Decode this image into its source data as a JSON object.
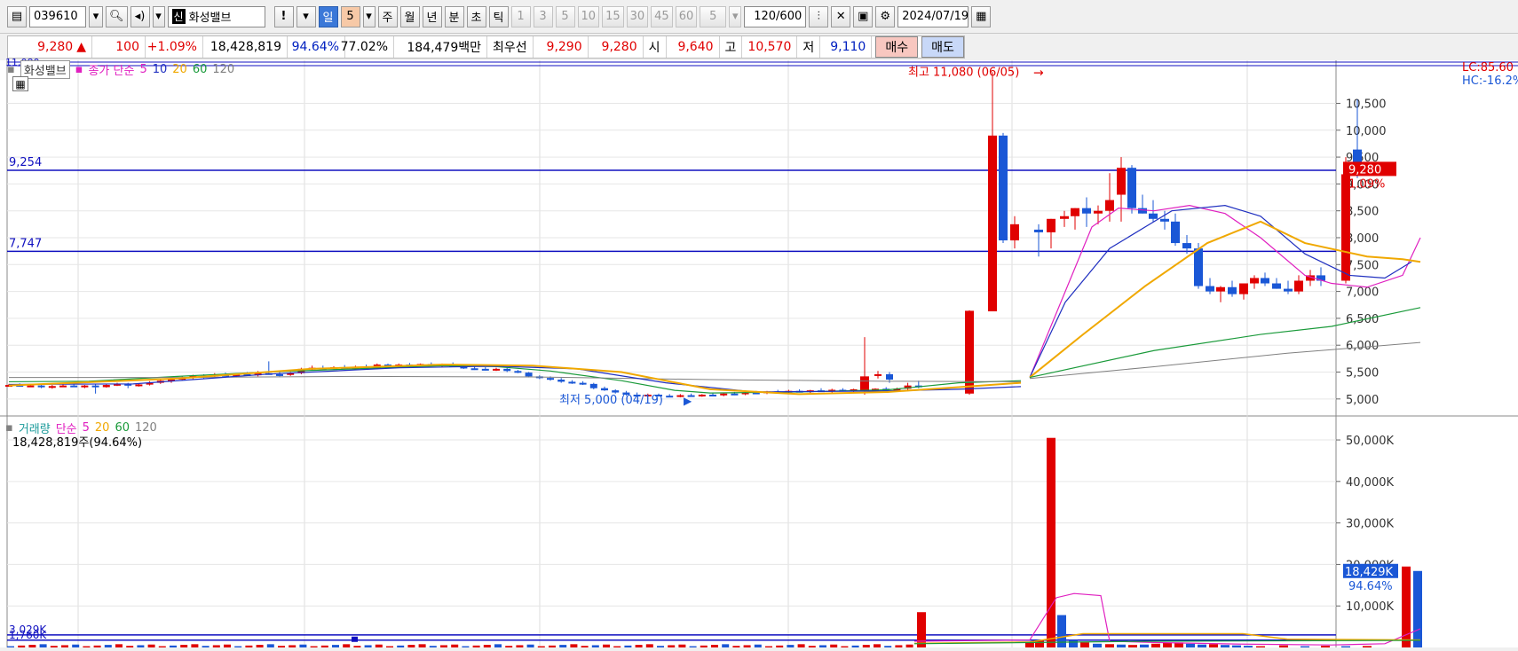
{
  "toolbar": {
    "code": "039610",
    "name_badge": "신",
    "stock_name": "화성밸브",
    "alert": "!",
    "period_day": "일",
    "period_value": "5",
    "period_week": "주",
    "period_month": "월",
    "period_year": "년",
    "period_min": "분",
    "period_sec": "초",
    "period_tick": "틱",
    "intervals": [
      "1",
      "3",
      "5",
      "10",
      "15",
      "30",
      "45",
      "60"
    ],
    "interval_select": "5",
    "count": "120",
    "count_max": "/600",
    "date": "2024/07/19"
  },
  "quote": {
    "price": "9,280",
    "change_arrow": "▲",
    "change": "100",
    "change_pct": "+1.09%",
    "volume": "18,428,819",
    "volume_ratio": "94.64%",
    "turnover": "77.02%",
    "amount": "184,479백만",
    "best_label": "최우선",
    "best_ask": "9,290",
    "best_bid": "9,280",
    "open_label": "시",
    "open": "9,640",
    "high_label": "고",
    "high": "10,570",
    "low_label": "저",
    "low": "9,110",
    "buy_button": "매수",
    "sell_button": "매도"
  },
  "price_panel": {
    "top_left_label": "11,080",
    "legend_name": "화성밸브",
    "legend_ma": "종가 단순",
    "ma_periods": [
      "5",
      "10",
      "20",
      "60",
      "120"
    ],
    "right_lc": "LC:85.60",
    "right_hc": "HC:-16.2%",
    "hline1_label": "9,254",
    "hline2_label": "7,747",
    "high_note": "최고 11,080 (06/05)",
    "low_note": "최저 5,000 (04/19)",
    "current_price": "9,280",
    "current_change": "1.09%",
    "y_ticks": [
      "10,500",
      "10,000",
      "9,500",
      "9,000",
      "8,500",
      "8,000",
      "7,500",
      "7,000",
      "6,500",
      "6,000",
      "5,500",
      "5,000"
    ]
  },
  "volume_panel": {
    "legend_name": "거래량",
    "legend_ma": "단순",
    "ma_periods": [
      "5",
      "20",
      "60",
      "120"
    ],
    "volume_text": "18,428,819주(94.64%)",
    "hline1_label": "3,029K",
    "hline2_label": "1,760K",
    "current_volume": "18,429K",
    "current_ratio": "94.64%",
    "y_ticks": [
      "50,000K",
      "40,000K",
      "30,000K",
      "20,000K",
      "10,000K"
    ]
  },
  "colors": {
    "up": "#e00000",
    "down": "#1a57d6",
    "ma5": "#e020c0",
    "ma10": "#2030c0",
    "ma20": "#f0a800",
    "ma60": "#1a9a3a",
    "ma120": "#808080",
    "hline": "#1010c0"
  },
  "chart_data": {
    "type": "candlestick",
    "y_axis_range": [
      4700,
      11300
    ],
    "y_ticks": [
      10500,
      10000,
      9500,
      9000,
      8500,
      8000,
      7500,
      7000,
      6500,
      6000,
      5500,
      5000
    ],
    "reference_lines": [
      9254,
      7747
    ],
    "highest": {
      "value": 11080,
      "date": "06/05"
    },
    "lowest": {
      "value": 5000,
      "date": "04/19"
    },
    "last_candle": {
      "open": 9640,
      "high": 10570,
      "low": 9110,
      "close": 9280
    },
    "prev_close": 9180,
    "volume_axis_range": [
      0,
      53000
    ],
    "volume_ticks": [
      50000,
      40000,
      30000,
      20000,
      10000
    ],
    "volume_reference_lines": [
      3029,
      1760
    ],
    "last_volume_k": 18429,
    "volume_peak_k": 50500
  }
}
